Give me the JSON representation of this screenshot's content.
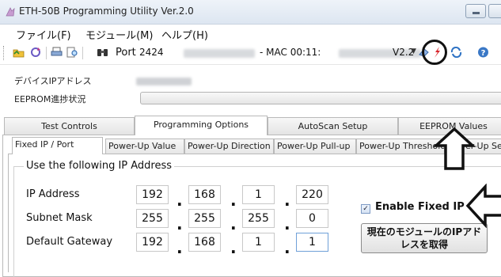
{
  "window": {
    "title": "ETH-50B Programming Utility Ver.2.0"
  },
  "menu": [
    "ファイル(F)",
    "モジュール(M)",
    "ヘルプ(H)"
  ],
  "toolbar": {
    "port_label": "Port",
    "port_value": "2424",
    "device": {
      "mac_prefix": "- MAC 00:11:",
      "version": "V2.2"
    }
  },
  "info": {
    "ip_label": "デバイスIPアドレス",
    "eeprom_label": "EEPROM進捗状況"
  },
  "main_tabs": [
    {
      "label": "Test Controls",
      "active": false
    },
    {
      "label": "Programming Options",
      "active": true
    },
    {
      "label": "AutoScan Setup",
      "active": false
    },
    {
      "label": "EEPROM Values",
      "active": false
    }
  ],
  "sub_tabs": [
    {
      "label": "Fixed IP / Port",
      "active": true
    },
    {
      "label": "Power-Up Value",
      "active": false
    },
    {
      "label": "Power-Up Direction",
      "active": false
    },
    {
      "label": "Power-Up Pull-up",
      "active": false
    },
    {
      "label": "Power-Up Threshold",
      "active": false
    },
    {
      "label": "Power-Up Se",
      "active": false
    }
  ],
  "group_title": "Use the following IP Address",
  "fields": [
    {
      "label": "IP Address",
      "octets": [
        "192",
        "168",
        "1",
        "220"
      ]
    },
    {
      "label": "Subnet Mask",
      "octets": [
        "255",
        "255",
        "255",
        "0"
      ]
    },
    {
      "label": "Default Gateway",
      "octets": [
        "192",
        "168",
        "1",
        "1"
      ]
    }
  ],
  "enable_fixed_ip": {
    "label": "Enable Fixed IP",
    "checked": true,
    "check_glyph": "✓"
  },
  "get_ip_button": {
    "line1": "現在のモジュールのIPアド",
    "line2": "レスを取得"
  },
  "icons": [
    "app-icon",
    "open-icon",
    "refresh-icon",
    "print-icon",
    "find-icon",
    "binoculars-icon",
    "eraser-icon",
    "flash-icon",
    "sync-icon",
    "help-icon"
  ],
  "colors": {
    "accent": "#3a78c6",
    "annotation": "#111111",
    "flash": "#d8232a"
  }
}
